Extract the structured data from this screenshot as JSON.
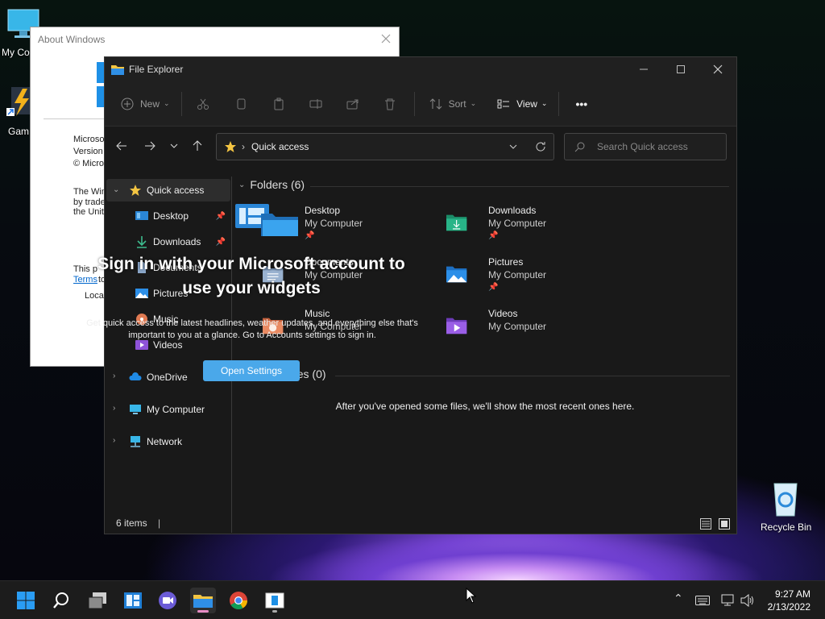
{
  "desktop": {
    "icons": [
      {
        "label": "My Co",
        "icon": "monitor-icon"
      },
      {
        "label": "Gam",
        "icon": "game-shortcut-icon"
      },
      {
        "label": "Recycle Bin",
        "icon": "recycle-bin-icon"
      }
    ]
  },
  "about_window": {
    "title": "About Windows",
    "lines": [
      "Microsof",
      "Version",
      "© Micros",
      "The Win",
      "by trade",
      "the Unit",
      "This p",
      "Terms",
      "to",
      "Local"
    ]
  },
  "explorer": {
    "title": "File Explorer",
    "toolbar": {
      "new_label": "New",
      "sort_label": "Sort",
      "view_label": "View",
      "more_label": "•••"
    },
    "address": {
      "path": "Quick access"
    },
    "search": {
      "placeholder": "Search Quick access"
    },
    "nav": {
      "items": [
        {
          "label": "Quick access"
        },
        {
          "label": "Desktop"
        },
        {
          "label": "Downloads"
        },
        {
          "label": "Documents"
        },
        {
          "label": "Pictures"
        },
        {
          "label": "Music"
        },
        {
          "label": "Videos"
        },
        {
          "label": "OneDrive"
        },
        {
          "label": "My Computer"
        },
        {
          "label": "Network"
        }
      ]
    },
    "folders_header": "Folders (6)",
    "folders": [
      {
        "name": "Desktop",
        "location": "My Computer",
        "color": "#2a86d6"
      },
      {
        "name": "Downloads",
        "location": "My Computer",
        "color": "#1fa37a"
      },
      {
        "name": "Documents",
        "location": "My Computer",
        "color": "#8aa6c8"
      },
      {
        "name": "Pictures",
        "location": "My Computer",
        "color": "#2c8fe8"
      },
      {
        "name": "Music",
        "location": "My Computer",
        "color": "#e07a52"
      },
      {
        "name": "Videos",
        "location": "My Computer",
        "color": "#8e52d8"
      }
    ],
    "recent_header": "Recent files (0)",
    "recent_empty": "After you've opened some files, we'll show the most recent ones here.",
    "status_items": "6 items"
  },
  "widgets": {
    "title": "Sign in with your Microsoft account to use your widgets",
    "body": "Get quick access to the latest headlines, weather updates, and everything else that's important to you at a glance. Go to Accounts settings to sign in.",
    "button": "Open Settings"
  },
  "taskbar": {
    "time": "9:27 AM",
    "date": "2/13/2022"
  }
}
